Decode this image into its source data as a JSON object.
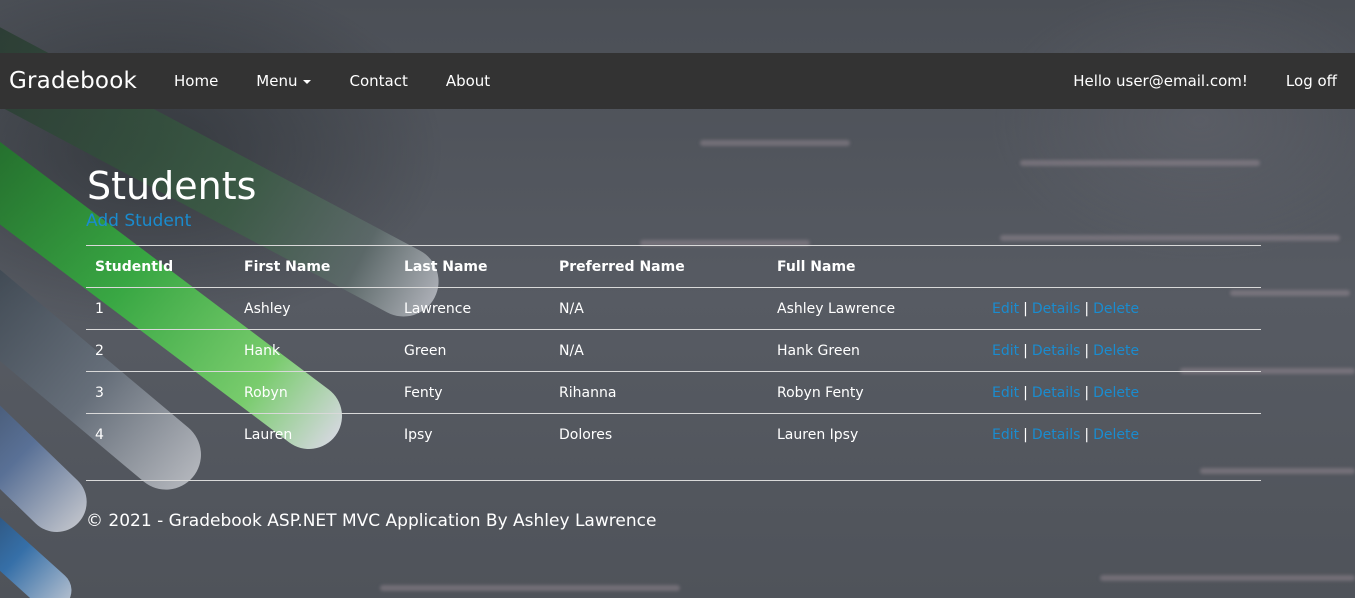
{
  "navbar": {
    "brand": "Gradebook",
    "links": {
      "home": "Home",
      "menu": "Menu",
      "contact": "Contact",
      "about": "About"
    },
    "greeting": "Hello user@email.com!",
    "logoff": "Log off"
  },
  "page": {
    "title": "Students",
    "add_link": "Add Student"
  },
  "table": {
    "headers": {
      "student_id": "StudentId",
      "first_name": "First Name",
      "last_name": "Last Name",
      "preferred_name": "Preferred Name",
      "full_name": "Full Name"
    },
    "rows": [
      {
        "id": "1",
        "first": "Ashley",
        "last": "Lawrence",
        "preferred": "N/A",
        "full": "Ashley Lawrence"
      },
      {
        "id": "2",
        "first": "Hank",
        "last": "Green",
        "preferred": "N/A",
        "full": "Hank Green"
      },
      {
        "id": "3",
        "first": "Robyn",
        "last": "Fenty",
        "preferred": "Rihanna",
        "full": "Robyn Fenty"
      },
      {
        "id": "4",
        "first": "Lauren",
        "last": "Ipsy",
        "preferred": "Dolores",
        "full": "Lauren Ipsy"
      }
    ],
    "actions": {
      "edit": "Edit",
      "details": "Details",
      "delete": "Delete",
      "separator": "|"
    }
  },
  "footer": {
    "text": "© 2021 - Gradebook ASP.NET MVC Application By Ashley Lawrence"
  },
  "colors": {
    "navbar_bg": "#333333",
    "link": "#1a8ccf",
    "text": "#ffffff"
  }
}
